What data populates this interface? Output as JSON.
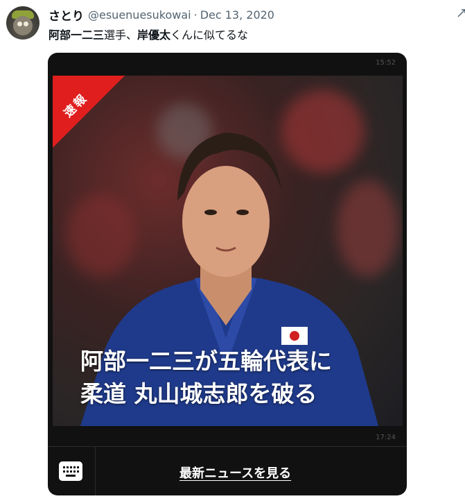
{
  "tweet": {
    "display_name": "さとり",
    "handle": "@esuenuesukowai",
    "separator": "·",
    "date": "Dec 13, 2020",
    "text_bold_1": "阿部一二三",
    "text_plain_1": "選手、",
    "text_bold_2": "岸優太",
    "text_plain_2": "くんに似てるな",
    "more_icon": "more-dots-icon"
  },
  "card": {
    "time_top": "15:52",
    "badge": "速報",
    "headline_line1": "阿部一二三が五輪代表に",
    "headline_line2": "柔道 丸山城志郎を破る",
    "time_bottom": "17:24",
    "keyboard_icon": "keyboard-icon",
    "cta_label": "最新ニュースを見る"
  },
  "colors": {
    "badge_red": "#e01e1e",
    "card_bg": "#111111",
    "muted_text": "#536471"
  }
}
